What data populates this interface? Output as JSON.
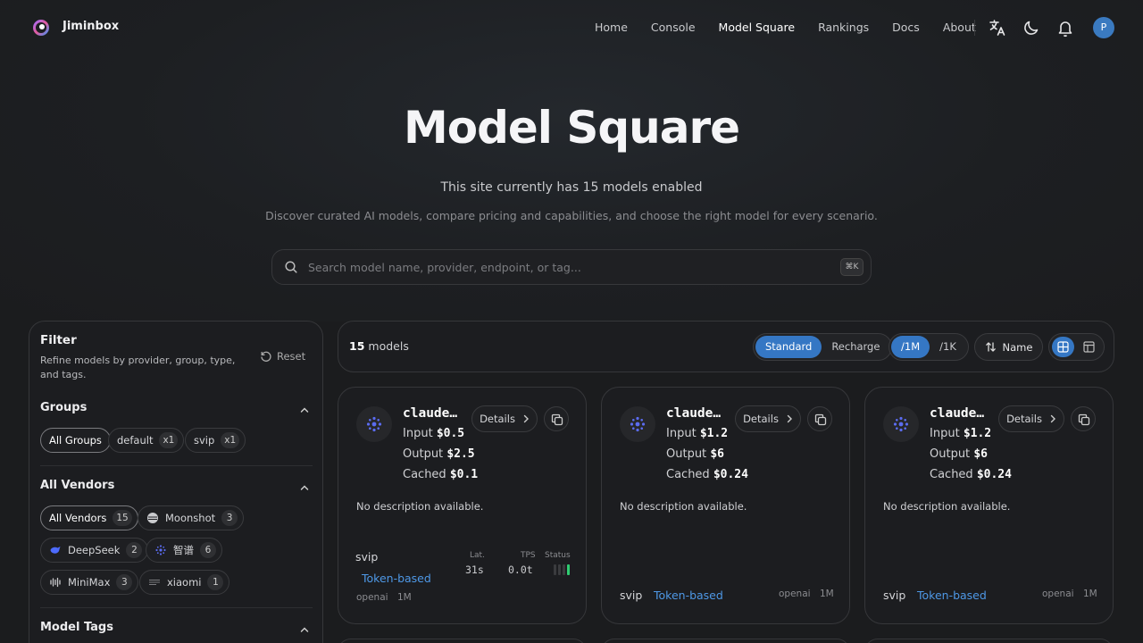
{
  "app": {
    "brand": "Jiminbox",
    "avatar_letter": "P"
  },
  "nav": {
    "items": [
      {
        "label": "Home"
      },
      {
        "label": "Console"
      },
      {
        "label": "Model Square",
        "active": true
      },
      {
        "label": "Rankings"
      },
      {
        "label": "Docs"
      },
      {
        "label": "About"
      }
    ]
  },
  "hero": {
    "title": "Model Square",
    "subtitle": "This site currently has 15 models enabled",
    "description": "Discover curated AI models, compare pricing and capabilities, and choose the right model for every scenario."
  },
  "search": {
    "placeholder": "Search model name, provider, endpoint, or tag...",
    "shortcut": "⌘K"
  },
  "filter": {
    "title": "Filter",
    "description": "Refine models by provider, group, type, and tags.",
    "reset_label": "Reset",
    "groups": {
      "title": "Groups",
      "chips": [
        {
          "label": "All Groups",
          "count": ""
        },
        {
          "label": "default",
          "count": "x1"
        },
        {
          "label": "svip",
          "count": "x1"
        }
      ]
    },
    "vendors": {
      "title": "All Vendors",
      "chips": [
        {
          "label": "All Vendors",
          "count": "15"
        },
        {
          "label": "Moonshot",
          "count": "3"
        },
        {
          "label": "DeepSeek",
          "count": "2"
        },
        {
          "label": "智谱",
          "count": "6"
        },
        {
          "label": "MiniMax",
          "count": "3"
        },
        {
          "label": "xiaomi",
          "count": "1"
        }
      ]
    },
    "tags": {
      "title": "Model Tags"
    }
  },
  "toolbar": {
    "count": "15",
    "count_suffix": "models",
    "pricing_mode": [
      "Standard",
      "Recharge"
    ],
    "unit": [
      "/1M",
      "/1K"
    ],
    "sort_label": "Name"
  },
  "cards": [
    {
      "name": "claude…",
      "details_label": "Details",
      "input_label": "Input",
      "input": "$0.5",
      "output_label": "Output",
      "output": "$2.5",
      "cached_label": "Cached",
      "cached": "$0.1",
      "description": "No description available.",
      "group": "svip",
      "billing": "Token-based",
      "endpoint": "openai",
      "unit": "1M",
      "lat_label": "Lat.",
      "lat": "31s",
      "tps_label": "TPS",
      "tps": "0.0t",
      "status_label": "Status"
    },
    {
      "name": "claude…",
      "details_label": "Details",
      "input_label": "Input",
      "input": "$1.2",
      "output_label": "Output",
      "output": "$6",
      "cached_label": "Cached",
      "cached": "$0.24",
      "description": "No description available.",
      "group": "svip",
      "billing": "Token-based",
      "endpoint": "openai",
      "unit": "1M"
    },
    {
      "name": "claude…",
      "details_label": "Details",
      "input_label": "Input",
      "input": "$1.2",
      "output_label": "Output",
      "output": "$6",
      "cached_label": "Cached",
      "cached": "$0.24",
      "description": "No description available.",
      "group": "svip",
      "billing": "Token-based",
      "endpoint": "openai",
      "unit": "1M"
    }
  ],
  "colors": {
    "accent": "#3577c4",
    "link": "#4e98e6",
    "status_ok": "#2fcc71",
    "background": "#1b1c1e"
  }
}
